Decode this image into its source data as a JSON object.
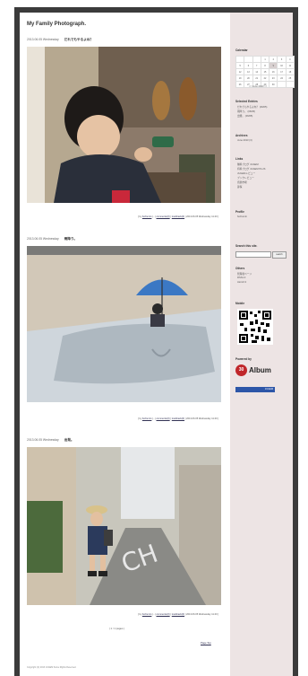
{
  "site": {
    "title": "My Family Photograph."
  },
  "posts": [
    {
      "date": "2013.06.05 Wednesday",
      "title": "だれでもやるよね？",
      "meta_by": "by",
      "meta_author": "fuchumin",
      "meta_comments": "comments(0)",
      "meta_trackback": "trackback(0)",
      "meta_time": "2013.06.05 Wednesday 11:40"
    },
    {
      "date": "2013.06.05 Wednesday",
      "title": "雨降り。",
      "meta_by": "by",
      "meta_author": "fuchumin",
      "meta_comments": "comments(0)",
      "meta_trackback": "trackback(0)",
      "meta_time": "2013.06.05 Wednesday 11:40"
    },
    {
      "date": "2013.06.05 Wednesday",
      "title": "出発。",
      "meta_by": "by",
      "meta_author": "fuchumin",
      "meta_comments": "comments(0)",
      "meta_trackback": "trackback(0)",
      "meta_time": "2013.06.05 Wednesday 11:40"
    }
  ],
  "pager": "| 1 / 1 pages |",
  "pagetop": "Page Top",
  "copyright": "Copyright (C) 2013 JUGEM Some Rights Reserved.",
  "sidebar": {
    "calendar_title": "Calendar",
    "calendar_rows": [
      [
        "",
        "",
        "",
        "1",
        "2",
        "3",
        "4"
      ],
      [
        "5",
        "6",
        "7",
        "8",
        "9",
        "10",
        "11"
      ],
      [
        "12",
        "13",
        "14",
        "15",
        "16",
        "17",
        "18"
      ],
      [
        "19",
        "20",
        "21",
        "22",
        "23",
        "24",
        "25"
      ],
      [
        "26",
        "27",
        "28",
        "29",
        "30",
        "",
        ""
      ]
    ],
    "calendar_nav": "<< June 2013 >>",
    "selected_title": "Selected Entries",
    "selected": [
      "だれでもやるよね？ (06/05)",
      "雨降り。 (06/05)",
      "出発。 (06/05)"
    ],
    "archives_title": "Archives",
    "archives": [
      "June 2013 (3)"
    ],
    "links_title": "Links",
    "links": [
      "無料ブログ JUGEM",
      "有料ブログ JUGEM PLUS",
      "JUGEMレビュー",
      "ブックレビュー",
      "音楽市場",
      "夢探"
    ],
    "profile_title": "Profile",
    "profile_name": "fuchumin",
    "search_title": "Search this site.",
    "search_btn": "search",
    "others_title": "Others",
    "others": [
      "管理者ページ",
      "RSS1.0",
      "Atom0.3"
    ],
    "mobile_title": "Mobile",
    "powered_title": "Powered by",
    "album_badge": "30",
    "album_text": "Album",
    "juden_text": "JUGEM"
  }
}
